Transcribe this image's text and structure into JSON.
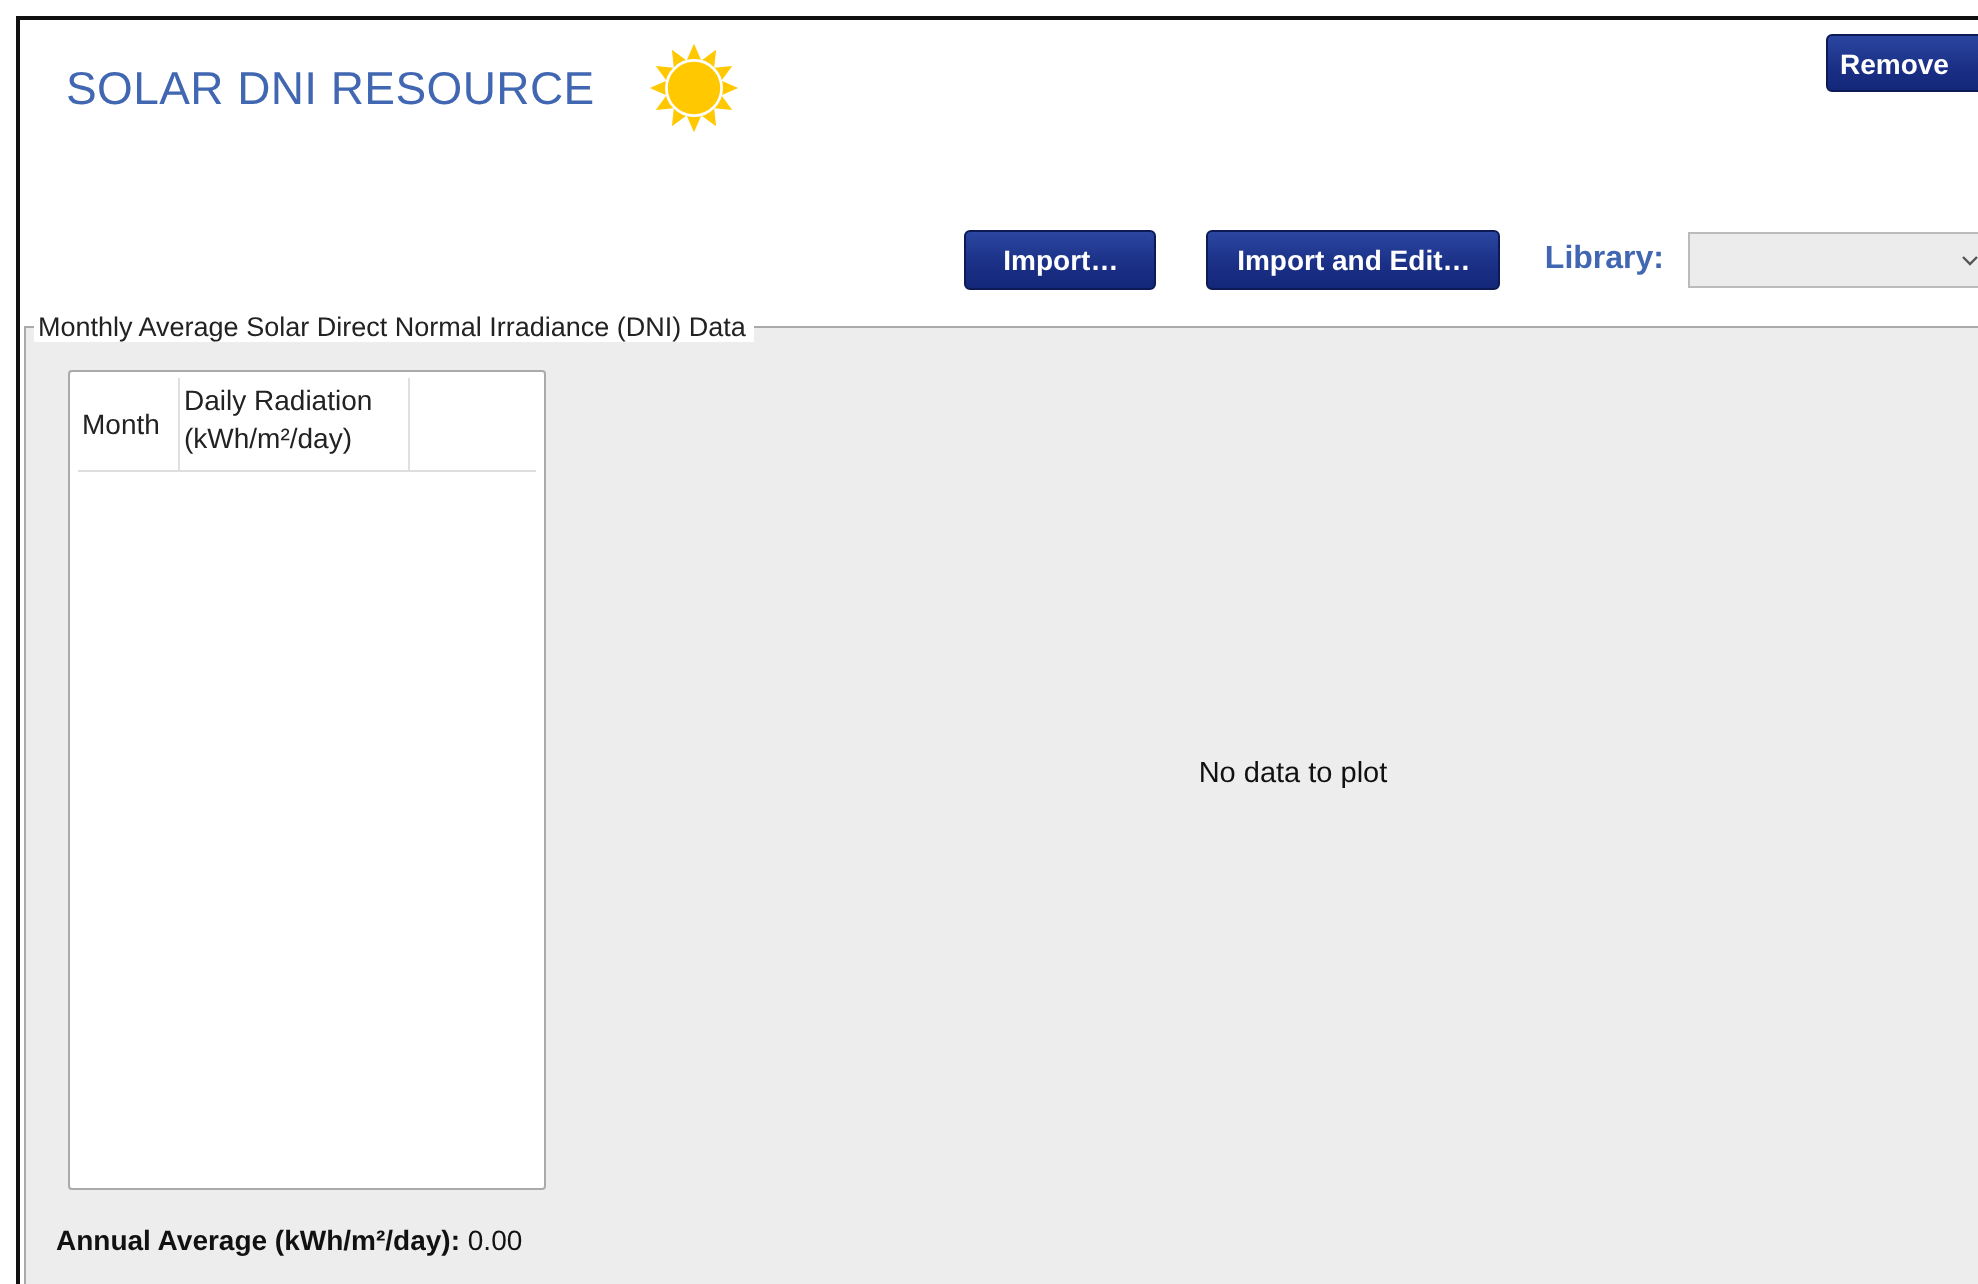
{
  "header": {
    "title": "SOLAR DNI RESOURCE",
    "remove_button": "Remove"
  },
  "toolbar": {
    "buttons": [
      "Import…",
      "Import and Edit…"
    ],
    "library_label": "Library:"
  },
  "group": {
    "title": "Monthly Average Solar Direct Normal Irradiance (DNI) Data",
    "table": {
      "columns": [
        "Month",
        "Daily Radiation (kWh/m²/day)"
      ]
    },
    "plot_message": "No data to plot",
    "annual_average": "**Annual Average (kWh/m²/day):** 0.00"
  }
}
